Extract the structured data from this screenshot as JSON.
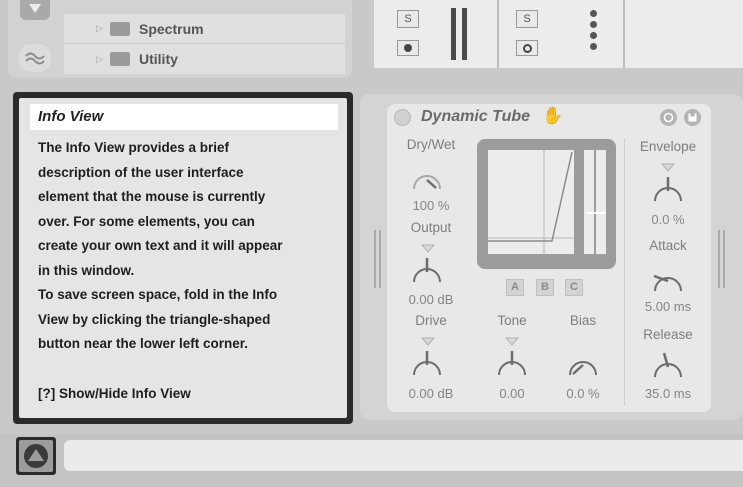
{
  "browser": {
    "items": [
      {
        "label": "Spectrum",
        "icon": "folder-icon"
      },
      {
        "label": "Utility",
        "icon": "folder-icon"
      }
    ]
  },
  "mixer": {
    "solo_label_1": "S",
    "solo_label_2": "S"
  },
  "info_view": {
    "title": "Info View",
    "body_lines": [
      "The Info View provides a brief",
      "description of the user interface",
      "element that the mouse is currently",
      "over. For some elements, you can",
      "create your own text and it will appear",
      "in this window.",
      "To save screen space, fold in the Info",
      "View by clicking the triangle-shaped",
      "button near the lower left corner."
    ],
    "toggle_text": "[?] Show/Hide Info View"
  },
  "device": {
    "name": "Dynamic Tube",
    "params": {
      "dry_wet": {
        "label": "Dry/Wet",
        "value": "100 %"
      },
      "output": {
        "label": "Output",
        "value": "0.00 dB"
      },
      "drive": {
        "label": "Drive",
        "value": "0.00 dB"
      },
      "tone": {
        "label": "Tone",
        "value": "0.00"
      },
      "bias": {
        "label": "Bias",
        "value": "0.0 %"
      },
      "envelope": {
        "label": "Envelope",
        "value": "0.0 %"
      },
      "attack": {
        "label": "Attack",
        "value": "5.00 ms"
      },
      "release": {
        "label": "Release",
        "value": "35.0 ms"
      }
    },
    "tube_buttons": [
      "A",
      "B",
      "C"
    ]
  },
  "colors": {
    "background": "#c9c9c9",
    "info_border": "#2b2b2b",
    "device_bg": "#e8e8e8",
    "display_bg": "#9c9c9c"
  }
}
